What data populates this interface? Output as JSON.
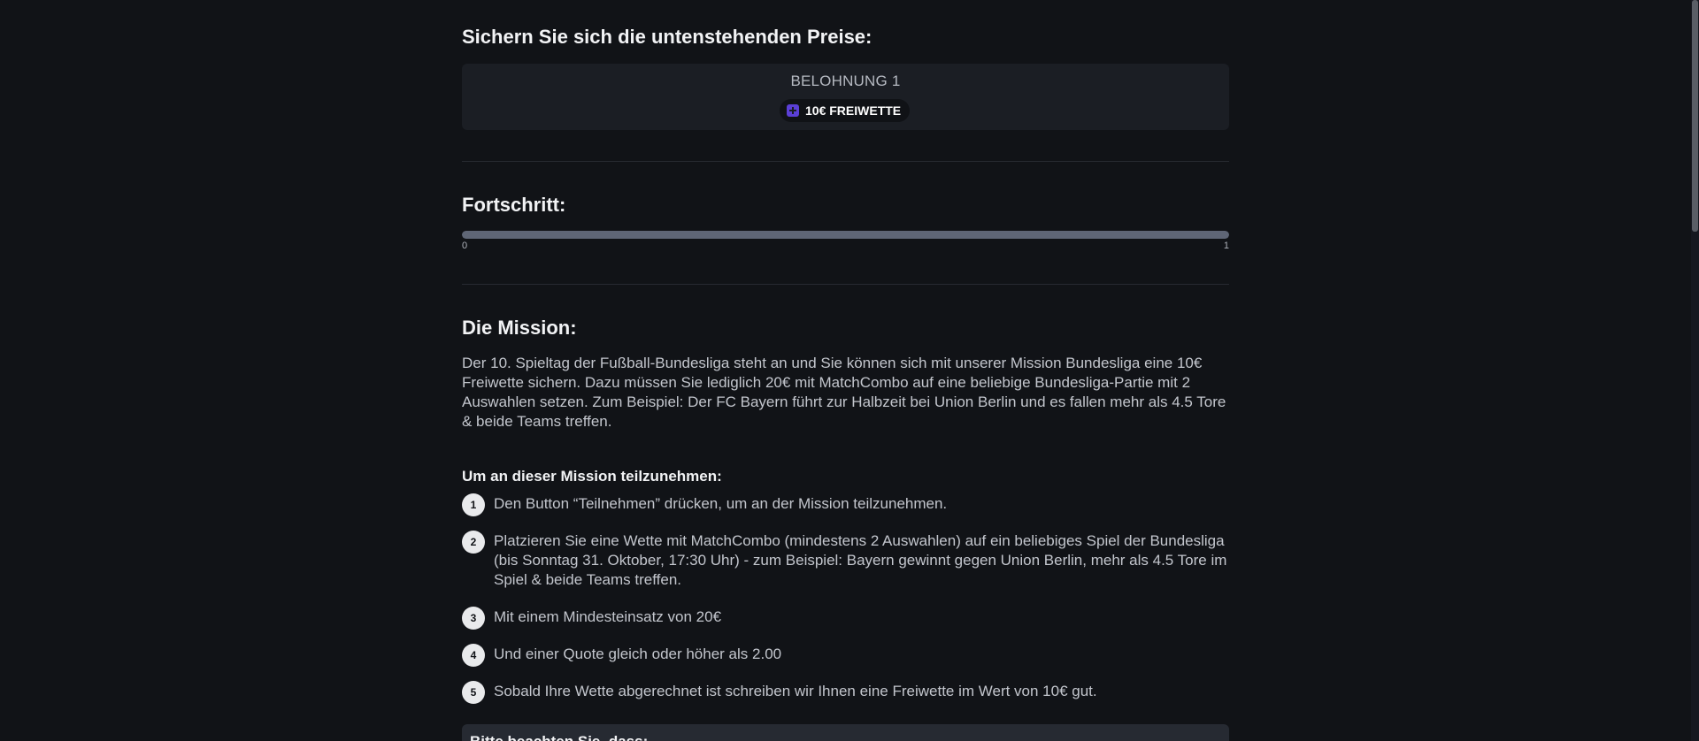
{
  "rewards": {
    "title": "Sichern Sie sich die untenstehenden Preise:",
    "reward_label": "BELOHNUNG 1",
    "reward_icon": "gift-icon",
    "reward_value": "10€ FREIWETTE"
  },
  "progress": {
    "title": "Fortschritt:",
    "min_label": "0",
    "max_label": "1",
    "fraction": 1.0
  },
  "mission": {
    "title": "Die Mission:",
    "description": "Der 10. Spieltag der Fußball-Bundesliga steht an und Sie können sich mit unserer Mission Bundesliga eine 10€ Freiwette sichern. Dazu müssen Sie lediglich 20€ mit MatchCombo auf eine beliebige Bundesliga-Partie mit 2 Auswahlen setzen. Zum Beispiel: Der FC Bayern führt zur Halbzeit bei Union Berlin und es fallen mehr als 4.5 Tore & beide Teams treffen.",
    "participate_heading": "Um an dieser Mission teilzunehmen:",
    "steps": [
      {
        "num": "1",
        "text": "Den Button “Teilnehmen” drücken, um an der Mission teilzunehmen."
      },
      {
        "num": "2",
        "text": "Platzieren Sie eine Wette mit MatchCombo (mindestens 2 Auswahlen) auf ein beliebiges Spiel der Bundesliga (bis Sonntag 31. Oktober, 17:30 Uhr) - zum Beispiel: Bayern gewinnt gegen Union Berlin, mehr als 4.5 Tore im Spiel & beide Teams treffen."
      },
      {
        "num": "3",
        "text": "Mit einem Mindesteinsatz von 20€"
      },
      {
        "num": "4",
        "text": "Und einer Quote gleich oder höher als 2.00"
      },
      {
        "num": "5",
        "text": "Sobald Ihre Wette abgerechnet ist schreiben wir Ihnen eine Freiwette im Wert von 10€ gut."
      }
    ]
  },
  "notice": {
    "title": "Bitte beachten Sie, dass:"
  },
  "colors": {
    "background": "#111317",
    "card": "#1b1e24",
    "accent": "#5b3fd6",
    "progress_fill": "#5f6676"
  }
}
